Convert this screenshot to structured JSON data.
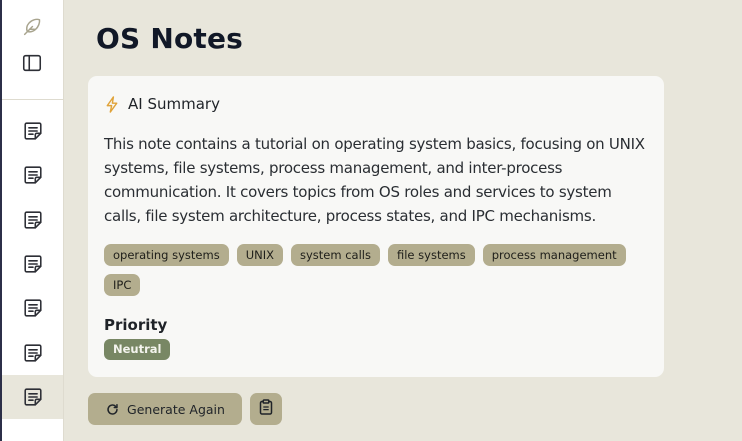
{
  "page": {
    "title": "OS Notes"
  },
  "sidebar": {
    "top_icons": [
      "feather-icon",
      "sidebar-panel-icon"
    ],
    "notes": [
      {
        "icon": "note-icon",
        "active": false
      },
      {
        "icon": "note-icon",
        "active": false
      },
      {
        "icon": "note-icon",
        "active": false
      },
      {
        "icon": "note-icon",
        "active": false
      },
      {
        "icon": "note-icon",
        "active": false
      },
      {
        "icon": "note-icon",
        "active": false
      },
      {
        "icon": "note-icon",
        "active": true
      }
    ]
  },
  "summary_card": {
    "icon": "lightning-bolt-icon",
    "heading": "AI Summary",
    "text": "This note contains a tutorial on operating system basics, focusing on UNIX systems, file systems, process management, and inter-process communication. It covers topics from OS roles and services to system calls, file system architecture, process states, and IPC mechanisms.",
    "tags": [
      "operating systems",
      "UNIX",
      "system calls",
      "file systems",
      "process management",
      "IPC"
    ],
    "priority_label": "Priority",
    "priority_value": "Neutral"
  },
  "actions": {
    "generate_again_label": "Generate Again",
    "generate_again_icon": "refresh-icon",
    "copy_icon": "clipboard-icon"
  },
  "colors": {
    "background": "#e8e6db",
    "card": "#f8f8f6",
    "tag": "#b3ad8e",
    "priority_badge": "#788764",
    "accent_bolt": "#e0a33a"
  }
}
